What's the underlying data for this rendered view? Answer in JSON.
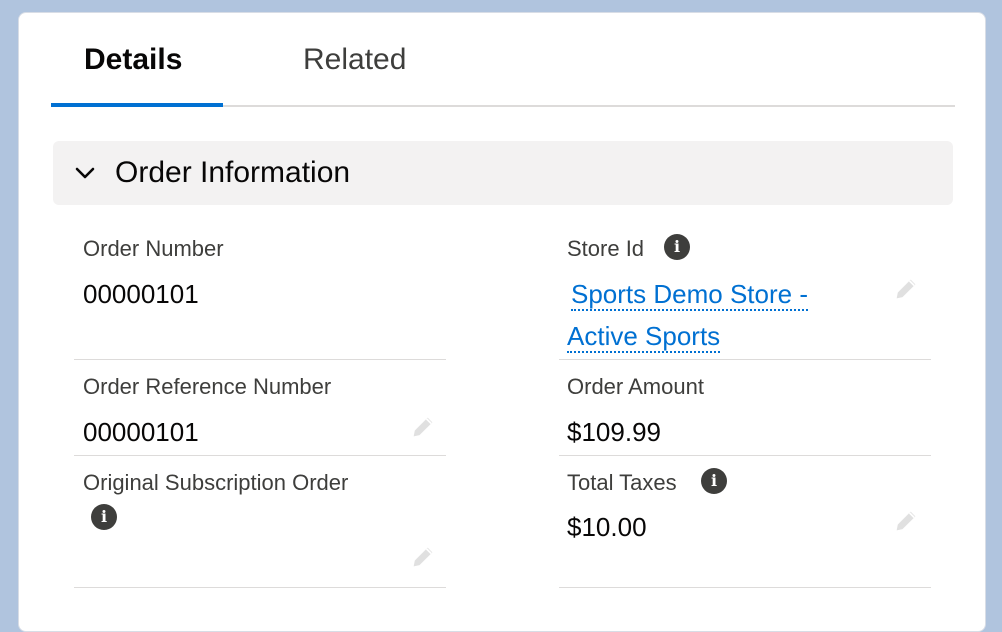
{
  "tabs": [
    {
      "label": "Details",
      "active": true
    },
    {
      "label": "Related",
      "active": false
    }
  ],
  "section": {
    "title": "Order Information",
    "expanded": true
  },
  "fields": {
    "order_number": {
      "label": "Order Number",
      "value": "00000101"
    },
    "store_id": {
      "label": "Store Id",
      "value_line1": "Sports Demo Store -",
      "value_line2": "Active Sports"
    },
    "order_reference_number": {
      "label": "Order Reference Number",
      "value": "00000101"
    },
    "order_amount": {
      "label": "Order Amount",
      "value": "$109.99"
    },
    "original_subscription_order": {
      "label": "Original Subscription Order",
      "value": ""
    },
    "total_taxes": {
      "label": "Total Taxes",
      "value": "$10.00"
    }
  },
  "colors": {
    "accent": "#0070d2",
    "background": "#b0c4de",
    "section_bg": "#f3f2f2"
  },
  "icons": {
    "info": "info-icon",
    "edit": "pencil-icon",
    "chevron": "chevron-down-icon"
  }
}
